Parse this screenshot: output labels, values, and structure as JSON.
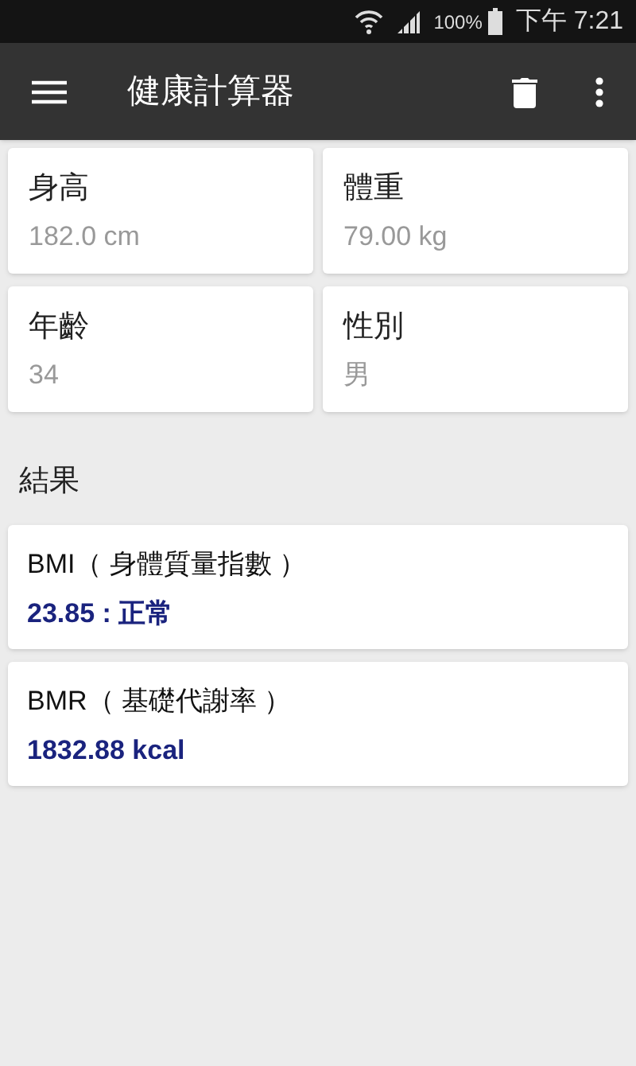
{
  "status_bar": {
    "battery": "100%",
    "time": "下午 7:21"
  },
  "app_bar": {
    "title": "健康計算器"
  },
  "inputs": [
    {
      "label": "身高",
      "value": "182.0 cm"
    },
    {
      "label": "體重",
      "value": "79.00 kg"
    },
    {
      "label": "年齡",
      "value": "34"
    },
    {
      "label": "性別",
      "value": "男"
    }
  ],
  "results_title": "結果",
  "results": [
    {
      "label": "BMI（ 身體質量指數 ）",
      "value": "23.85 : 正常"
    },
    {
      "label": "BMR（ 基礎代謝率 ）",
      "value": "1832.88 kcal"
    }
  ]
}
